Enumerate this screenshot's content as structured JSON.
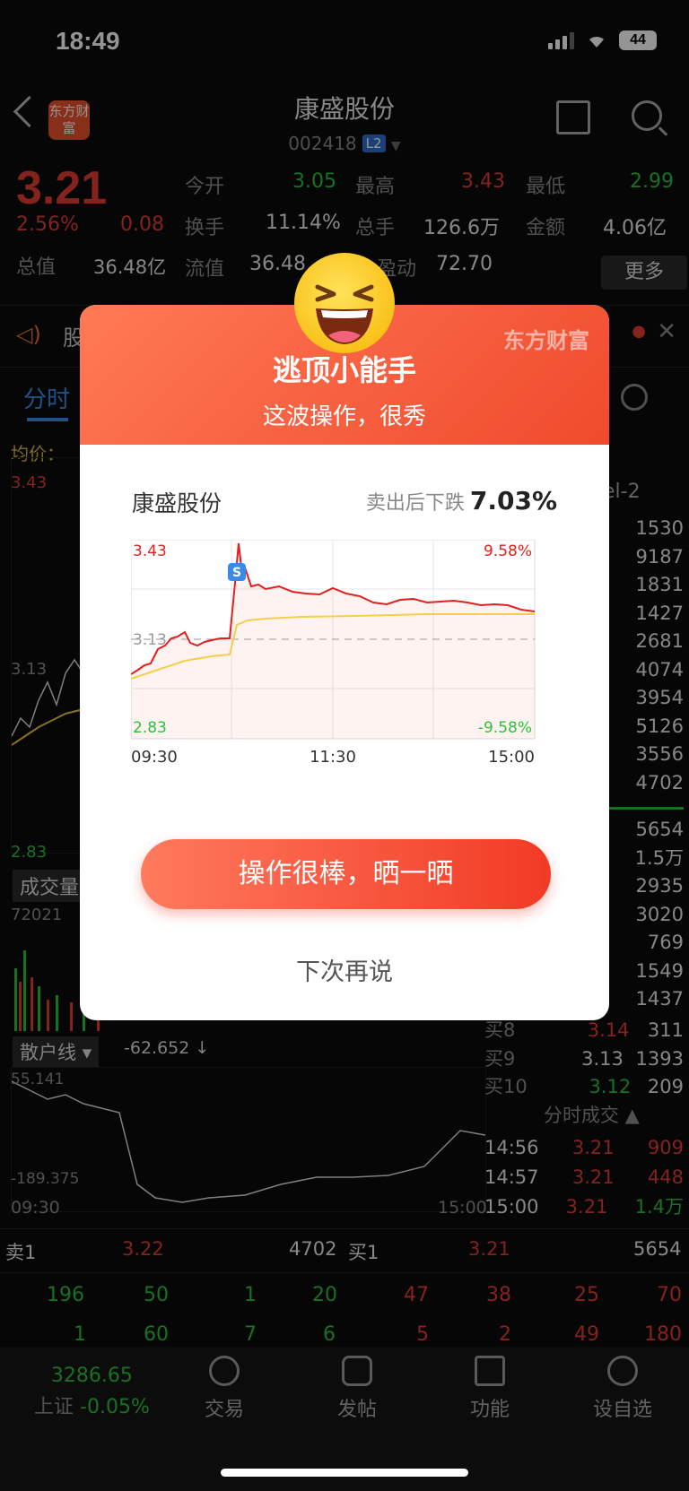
{
  "status": {
    "time": "18:49",
    "battery": "44"
  },
  "header": {
    "logo": "东方财富",
    "title": "康盛股份",
    "code": "002418",
    "badge": "L2"
  },
  "quote": {
    "price": "3.21",
    "pct": "2.56%",
    "change": "0.08",
    "open_label": "今开",
    "open": "3.05",
    "high_label": "最高",
    "high": "3.43",
    "low_label": "最低",
    "low": "2.99",
    "turnover_label": "换手",
    "turnover": "11.14%",
    "vol_label": "总手",
    "vol": "126.6万",
    "amount_label": "金额",
    "amount": "4.06亿",
    "mcap_label": "总值",
    "mcap": "36.48亿",
    "float_label": "流值",
    "float": "36.48",
    "pe_label": "盈动",
    "pe": "72.70",
    "more": "更多"
  },
  "strip_text": "股",
  "tabs": {
    "active": "分时",
    "avg": "均价：",
    "level": "el-2"
  },
  "chart_side": {
    "top": "3.43",
    "mid": "3.13",
    "bottom": "2.83",
    "vol_label": "成交量",
    "vol_max": "72021",
    "line_label": "散户线",
    "line_val": "-62.652 ↓",
    "line_top": "55.141",
    "line_bottom": "-189.375",
    "t_start": "09:30",
    "t_end": "15:00"
  },
  "orderbook": {
    "asks": [
      "1530",
      "9187",
      "1831",
      "1427",
      "2681",
      "4074",
      "3954",
      "5126",
      "3556",
      "4702"
    ],
    "bids": [
      "5654",
      "1.5万",
      "2935",
      "3020",
      "769",
      "1549",
      "1437"
    ],
    "bid_rows": [
      {
        "label": "买8",
        "price": "3.14",
        "vol": "311"
      },
      {
        "label": "买9",
        "price": "3.13",
        "vol": "1393"
      },
      {
        "label": "买10",
        "price": "3.12",
        "vol": "209"
      }
    ],
    "ticks_title": "分时成交",
    "ticks": [
      {
        "t": "14:56",
        "p": "3.21",
        "v": "909"
      },
      {
        "t": "14:57",
        "p": "3.21",
        "v": "448"
      },
      {
        "t": "15:00",
        "p": "3.21",
        "v": "1.4万"
      }
    ]
  },
  "level1": {
    "sell_label": "卖1",
    "sell_price": "3.22",
    "sell_vol": "4702",
    "buy_label": "买1",
    "buy_price": "3.21",
    "buy_vol": "5654",
    "row1_left": [
      "196",
      "50",
      "1",
      "20"
    ],
    "row1_right": [
      "47",
      "38",
      "25",
      "70"
    ],
    "row2_left": [
      "1",
      "60",
      "7",
      "6"
    ],
    "row2_right": [
      "5",
      "2",
      "49",
      "180"
    ]
  },
  "bottom_nav": {
    "index_val": "3286.65",
    "index_name": "上证",
    "index_pct": "-0.05%",
    "items": [
      "交易",
      "发帖",
      "功能",
      "设自选"
    ]
  },
  "modal": {
    "brand": "东方财富",
    "title": "逃顶小能手",
    "subtitle": "这波操作，很秀",
    "stock": "康盛股份",
    "fall_label": "卖出后下跌",
    "fall_value": "7.03%",
    "chart_top": "3.43",
    "chart_mid": "3.13",
    "chart_bottom": "2.83",
    "pct_top": "9.58%",
    "pct_bottom": "-9.58%",
    "t1": "09:30",
    "t2": "11:30",
    "t3": "15:00",
    "marker": "S",
    "button": "操作很棒，晒一晒",
    "later": "下次再说"
  },
  "colors": {
    "up": "#e33b35",
    "down": "#2bc23b",
    "accent": "#f04a2e"
  }
}
